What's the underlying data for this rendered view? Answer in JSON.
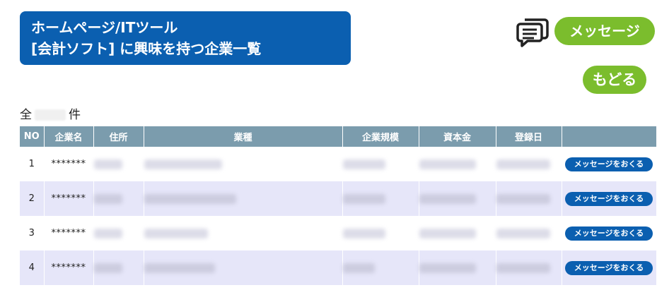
{
  "header": {
    "title_line1": "ホームページ/ITツール",
    "title_line2": "[会計ソフト] に興味を持つ企業一覧"
  },
  "top_actions": {
    "message_label": "メッセージ",
    "back_label": "もどる"
  },
  "count": {
    "prefix": "全",
    "suffix": "件"
  },
  "table": {
    "columns": [
      "NO",
      "企業名",
      "住所",
      "業種",
      "企業規模",
      "資本金",
      "登録日",
      ""
    ],
    "rows": [
      {
        "no": "1",
        "name": "*******",
        "action": "メッセージをおくる"
      },
      {
        "no": "2",
        "name": "*******",
        "action": "メッセージをおくる"
      },
      {
        "no": "3",
        "name": "*******",
        "action": "メッセージをおくる"
      },
      {
        "no": "4",
        "name": "*******",
        "action": "メッセージをおくる"
      }
    ]
  },
  "colors": {
    "primary": "#0b5fb0",
    "accent_green": "#7bbd2d",
    "header_bg": "#7b9cad",
    "row_alt": "#e6e6f9"
  }
}
